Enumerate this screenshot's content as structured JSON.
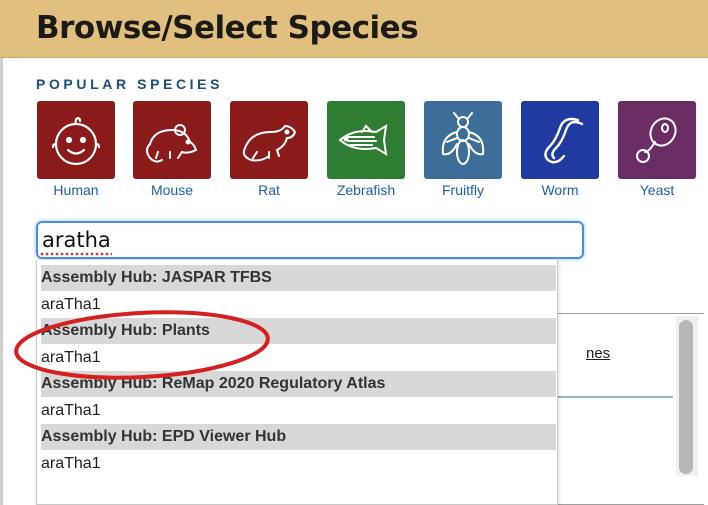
{
  "page": {
    "title": "Browse/Select Species"
  },
  "popular": {
    "heading": "POPULAR SPECIES",
    "species": [
      {
        "name": "Human",
        "icon": "human-face-icon",
        "color": "#8b1a1a"
      },
      {
        "name": "Mouse",
        "icon": "mouse-icon",
        "color": "#8b1a1a"
      },
      {
        "name": "Rat",
        "icon": "rat-icon",
        "color": "#8b1a1a"
      },
      {
        "name": "Zebrafish",
        "icon": "fish-icon",
        "color": "#2e7d32"
      },
      {
        "name": "Fruitfly",
        "icon": "fly-icon",
        "color": "#3d6e99"
      },
      {
        "name": "Worm",
        "icon": "worm-icon",
        "color": "#1f3aa0"
      },
      {
        "name": "Yeast",
        "icon": "yeast-icon",
        "color": "#6a2d63"
      }
    ]
  },
  "search": {
    "value": "aratha"
  },
  "results": [
    {
      "group": "Assembly Hub: JASPAR TFBS",
      "assembly": "araTha1"
    },
    {
      "group": "Assembly Hub: Plants",
      "assembly": "araTha1"
    },
    {
      "group": "Assembly Hub: ReMap 2020 Regulatory Atlas",
      "assembly": "araTha1"
    },
    {
      "group": "Assembly Hub: EPD Viewer Hub",
      "assembly": "araTha1"
    }
  ],
  "background": {
    "link_fragment": "nes"
  },
  "annotation": {
    "color": "#d42020"
  }
}
